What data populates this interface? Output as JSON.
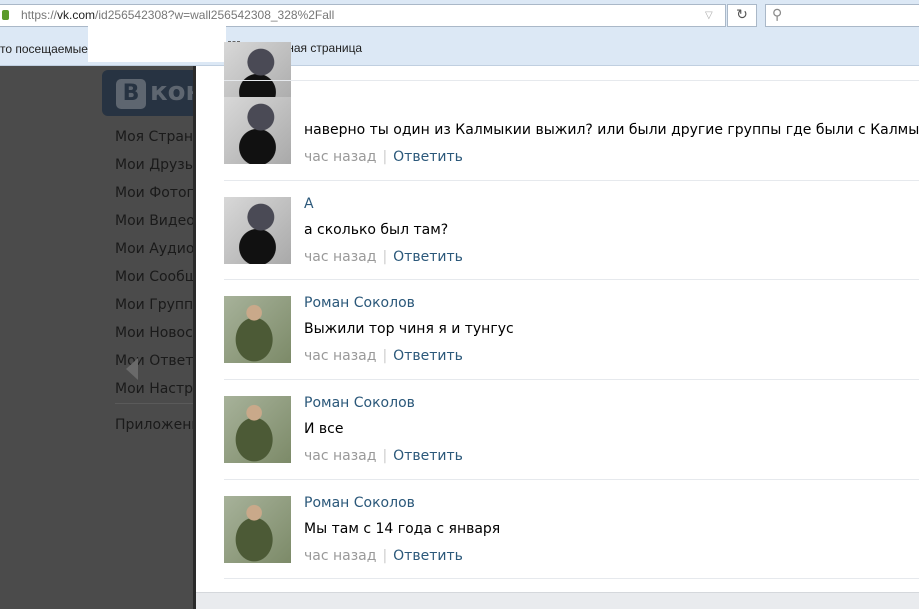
{
  "browser": {
    "url_prefix": "https://",
    "url_domain": "vk.com",
    "url_rest": "/id256542308?w=wall256542308_328%2Fall",
    "reload": "↻",
    "search": "🔍"
  },
  "bookmarks": [
    "то посещаемые",
    "Начальная страница"
  ],
  "sidebar": {
    "logo_letter": "В",
    "logo_text": "контакте",
    "items": [
      "Моя Страница",
      "Мои Друзья",
      "Мои Фотографии",
      "Мои Видеозаписи",
      "Мои Аудиозаписи",
      "Мои Сообщения",
      "Мои Группы",
      "Мои Новости",
      "Мои Ответы",
      "Мои Настройки",
      "Приложения"
    ]
  },
  "comments": [
    {
      "author": "",
      "text": "наверно ты один из Калмыкии выжил? или были другие группы где были с Калмыкии?",
      "time": "час назад",
      "reply": "Ответить",
      "avatar": "girl"
    },
    {
      "author": "А",
      "text": "а сколько был там?",
      "time": "час назад",
      "reply": "Ответить",
      "avatar": "girl"
    },
    {
      "author": "Роман Соколов",
      "text": "Выжили тор чиня я и тунгус",
      "time": "час назад",
      "reply": "Ответить",
      "avatar": "man"
    },
    {
      "author": "Роман Соколов",
      "text": "И все",
      "time": "час назад",
      "reply": "Ответить",
      "avatar": "man"
    },
    {
      "author": "Роман Соколов",
      "text": "Мы там с 14 года с января",
      "time": "час назад",
      "reply": "Ответить",
      "avatar": "man"
    }
  ]
}
